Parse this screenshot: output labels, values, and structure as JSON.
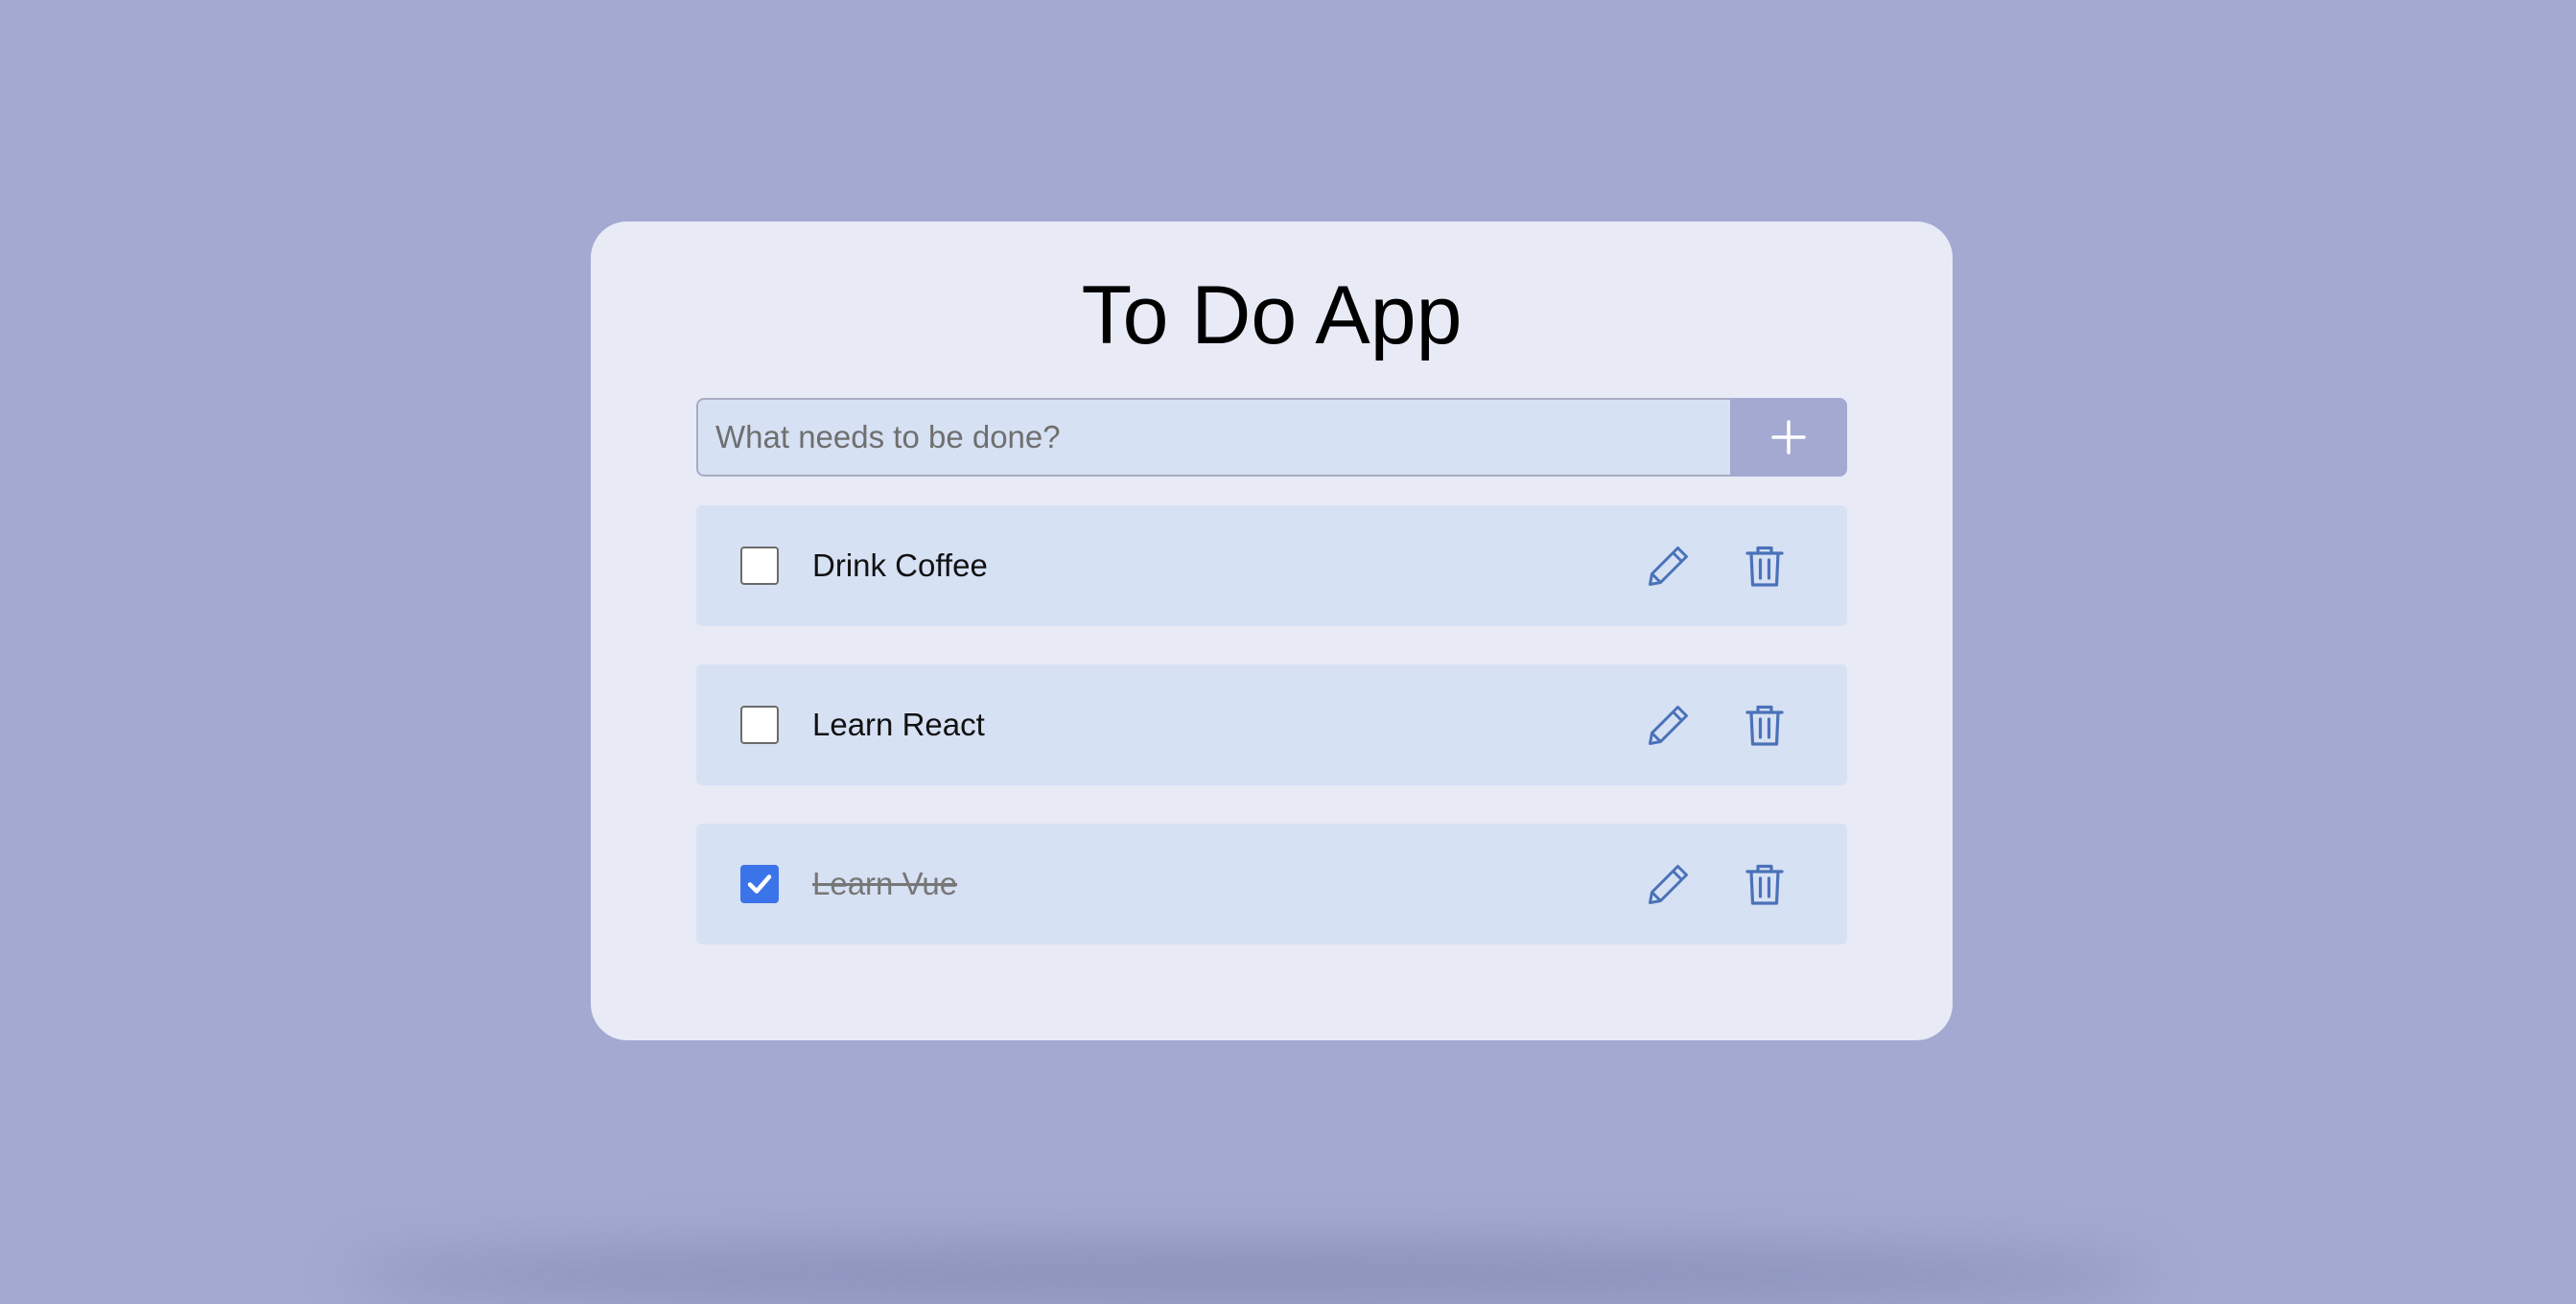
{
  "app": {
    "title": "To Do App"
  },
  "new_todo": {
    "placeholder": "What needs to be done?",
    "value": "",
    "add_button_icon": "plus-icon"
  },
  "todos": [
    {
      "text": "Drink Coffee",
      "completed": false
    },
    {
      "text": "Learn React",
      "completed": false
    },
    {
      "text": "Learn Vue",
      "completed": true
    }
  ],
  "icons": {
    "edit": "pencil-icon",
    "delete": "trash-icon",
    "check": "check-icon"
  },
  "colors": {
    "background": "#a3a9d1",
    "card": "#e8eaf6",
    "item": "#d7e1f4",
    "icon": "#4a72b8",
    "checkbox_checked": "#3b74e8",
    "add_button": "#a3a9d1"
  }
}
